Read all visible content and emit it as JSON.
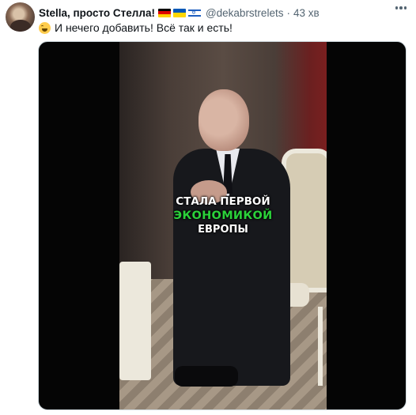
{
  "tweet": {
    "display_name": "Stella, просто Стелла!",
    "flags": [
      "flag-germany-icon",
      "flag-ukraine-icon",
      "flag-israel-icon"
    ],
    "handle": "@dekabrstrelets",
    "separator": "·",
    "time": "43 хв",
    "text": "И нечего добавить! Всё так и есть!",
    "emoji": "grinning-sweat-face-icon"
  },
  "media": {
    "caption": {
      "line1": "СТАЛА ПЕРВОЙ",
      "line2": "ЭКОНОМИКОЙ",
      "line3": "ЕВРОПЫ"
    }
  },
  "colors": {
    "text_primary": "#0f1419",
    "text_secondary": "#536471",
    "caption_accent": "#2bd13a"
  }
}
